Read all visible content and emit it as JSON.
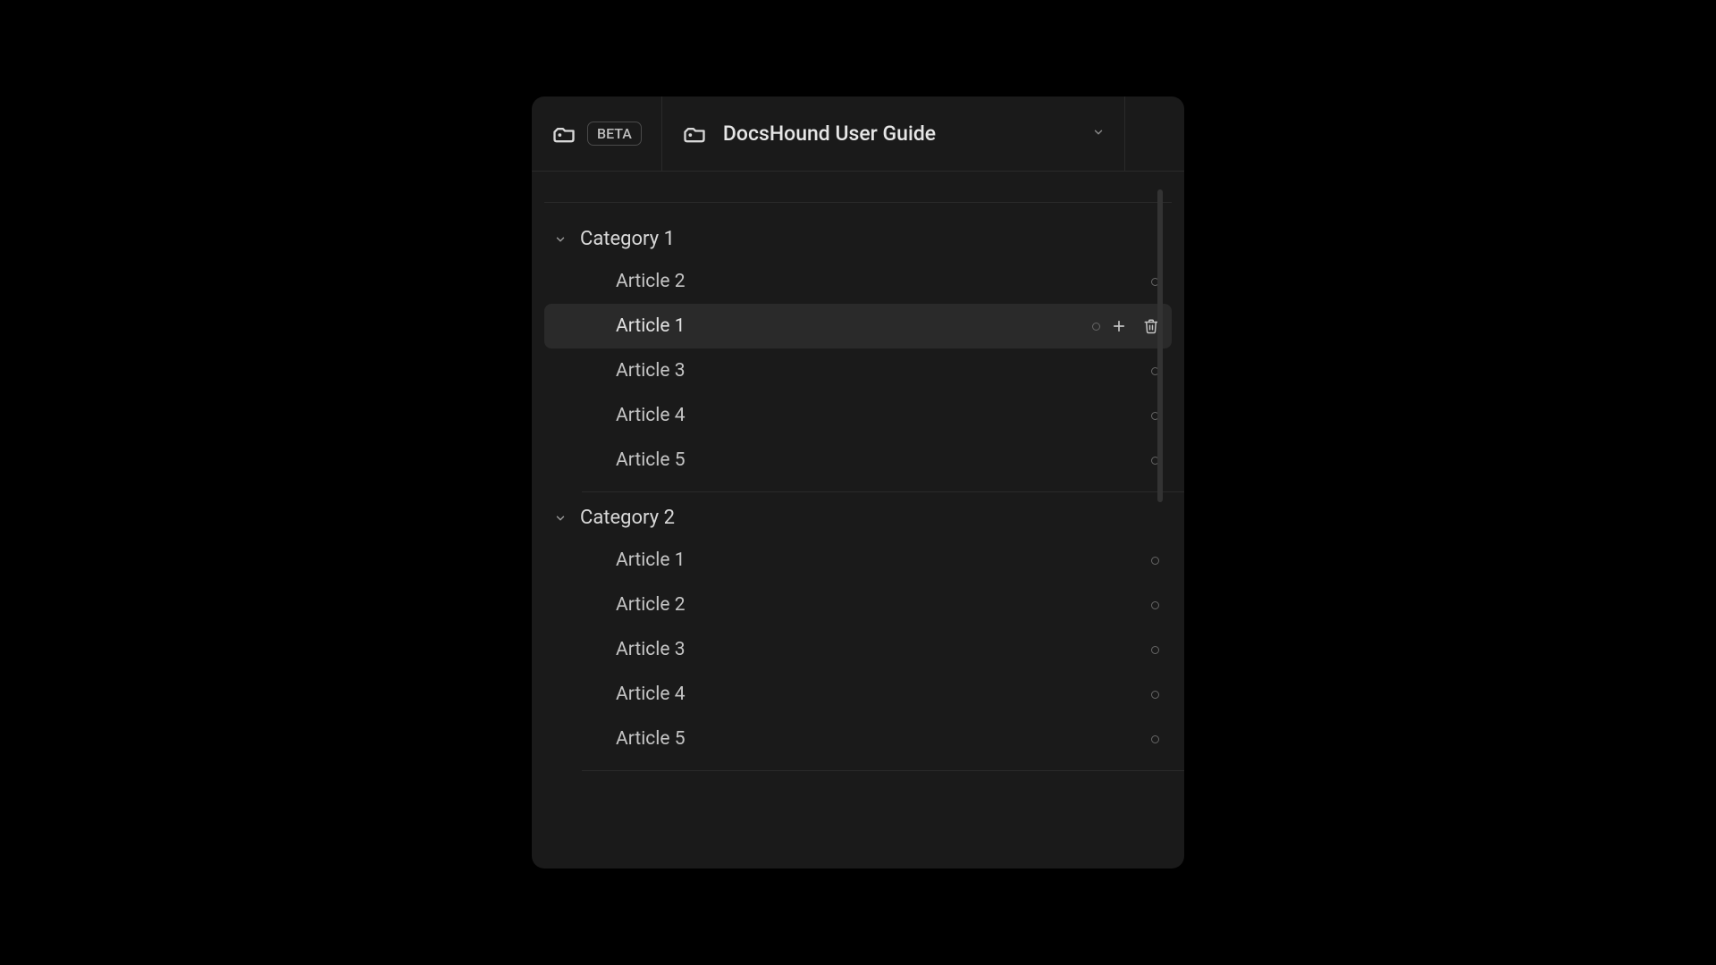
{
  "header": {
    "badge": "BETA",
    "title": "DocsHound User Guide"
  },
  "categories": [
    {
      "name": "Category 1",
      "articles": [
        {
          "title": "Article 2",
          "selected": false
        },
        {
          "title": "Article 1",
          "selected": true
        },
        {
          "title": "Article 3",
          "selected": false
        },
        {
          "title": "Article 4",
          "selected": false
        },
        {
          "title": "Article 5",
          "selected": false
        }
      ]
    },
    {
      "name": "Category 2",
      "articles": [
        {
          "title": "Article 1",
          "selected": false
        },
        {
          "title": "Article 2",
          "selected": false
        },
        {
          "title": "Article 3",
          "selected": false
        },
        {
          "title": "Article 4",
          "selected": false
        },
        {
          "title": "Article 5",
          "selected": false
        }
      ]
    }
  ]
}
